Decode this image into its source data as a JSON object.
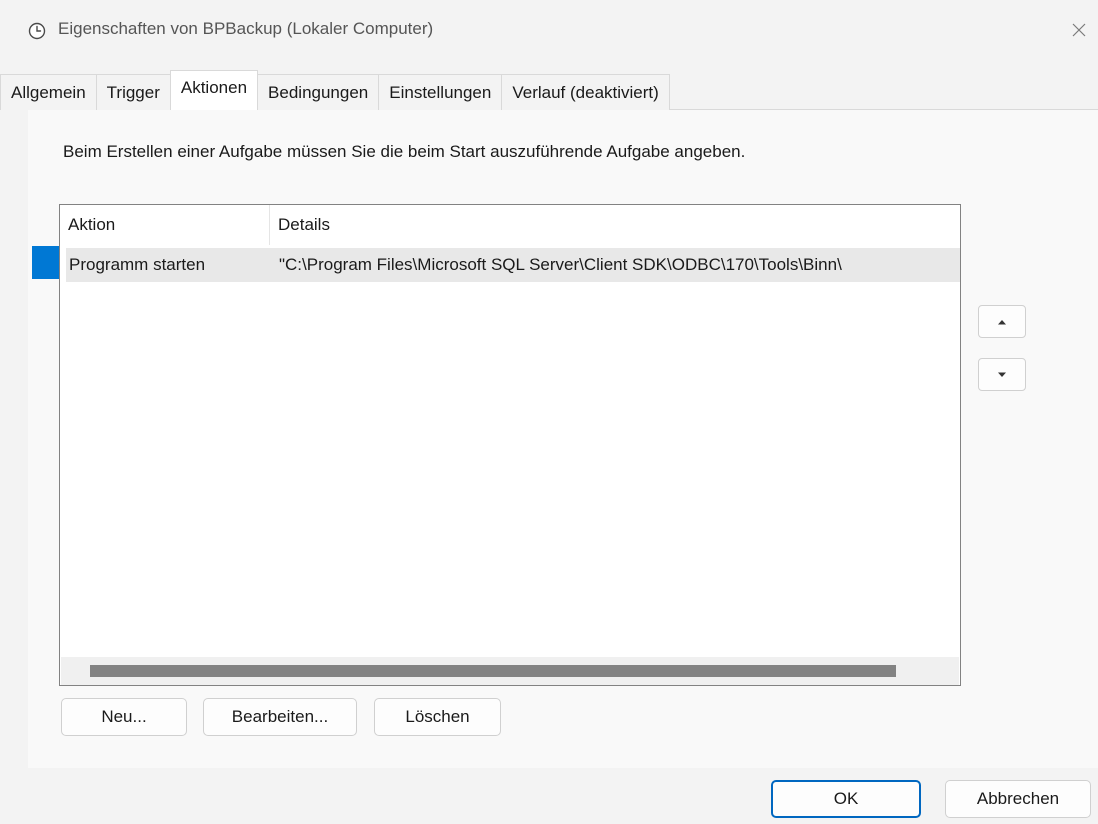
{
  "window": {
    "title": "Eigenschaften von BPBackup (Lokaler Computer)",
    "icon": "clock-icon",
    "close_icon": "close-icon"
  },
  "tabs": [
    {
      "label": "Allgemein",
      "active": false
    },
    {
      "label": "Trigger",
      "active": false
    },
    {
      "label": "Aktionen",
      "active": true
    },
    {
      "label": "Bedingungen",
      "active": false
    },
    {
      "label": "Einstellungen",
      "active": false
    },
    {
      "label": "Verlauf (deaktiviert)",
      "active": false
    }
  ],
  "actions_panel": {
    "instruction": "Beim Erstellen einer Aufgabe müssen Sie die beim Start auszuführende Aufgabe angeben.",
    "columns": [
      "Aktion",
      "Details"
    ],
    "rows": [
      {
        "aktion": "Programm starten",
        "details": "\"C:\\Program Files\\Microsoft SQL Server\\Client SDK\\ODBC\\170\\Tools\\Binn\\"
      }
    ],
    "move_up_icon": "triangle-up-icon",
    "move_down_icon": "triangle-down-icon",
    "buttons": {
      "new": "Neu...",
      "edit": "Bearbeiten...",
      "delete": "Löschen"
    }
  },
  "footer": {
    "ok": "OK",
    "cancel": "Abbrechen"
  },
  "colors": {
    "accent": "#0078d4",
    "selected_row": "#e8e8e8",
    "primary_border": "#0067c0"
  }
}
